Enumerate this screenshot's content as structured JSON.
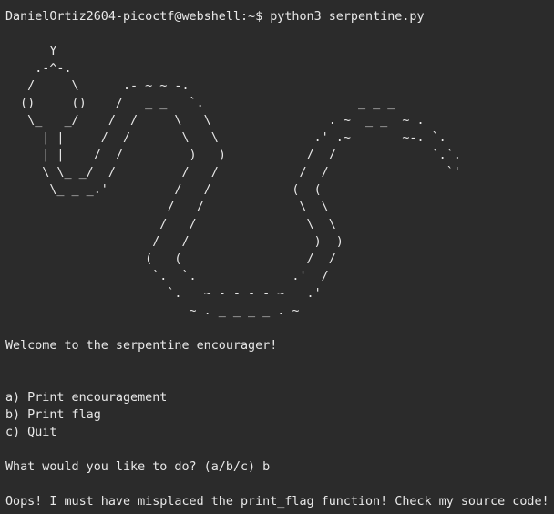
{
  "terminal": {
    "prompt": "DanielOrtiz2604-picoctf@webshell:~$",
    "command": "python3 serpentine.py",
    "ascii_art": "      Y\n    .-^-.\n   /     \\      .- ~ ~ -.\n  ()     ()    /   _ _   `.                     _ _ _\n   \\_   _/    /  /     \\   \\                . ~  _ _  ~ .\n     | |     /  /       \\   \\             .' .~       ~-. `.\n     | |    /  /         )   )           /  /             `.`.\n     \\ \\_ _/  /         /   /           /  /                `'\n      \\_ _ _.'         /   /           (  (\n                      /   /             \\  \\\n                     /   /               \\  \\\n                    /   /                 )  )\n                   (   (                 /  /\n                    `.  `.             .'  /\n                      `.   ~ - - - - ~   .'\n                         ~ . _ _ _ _ . ~",
    "welcome": "Welcome to the serpentine encourager!",
    "menu": [
      "a) Print encouragement",
      "b) Print flag",
      "c) Quit"
    ],
    "question": "What would you like to do? (a/b/c) b",
    "response": "Oops! I must have misplaced the print_flag function! Check my source code!"
  }
}
